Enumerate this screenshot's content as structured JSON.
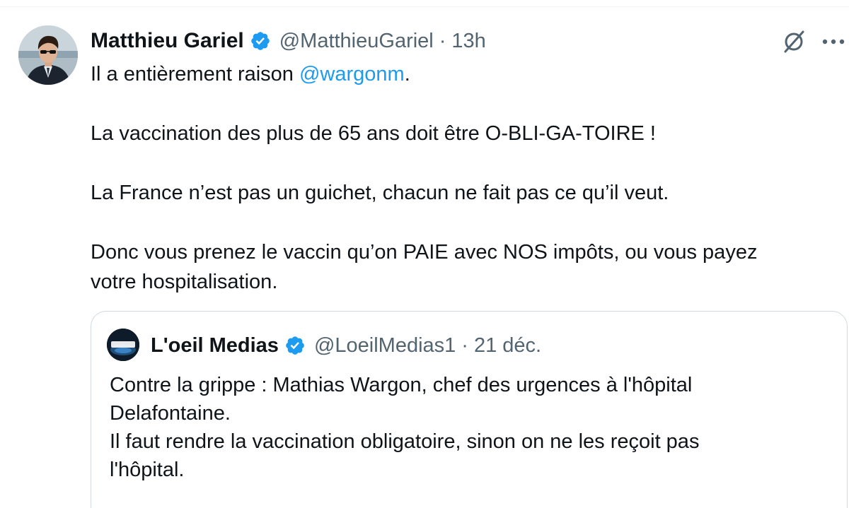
{
  "tweet": {
    "display_name": "Matthieu Gariel",
    "handle": "@MatthieuGariel",
    "separator": "·",
    "time": "13h",
    "text_line1_prefix": "Il a entièrement raison ",
    "text_line1_mention": "@wargonm",
    "text_line1_suffix": ".",
    "paragraph2": "La vaccination des plus de 65 ans doit être O-BLI-GA-TOIRE !",
    "paragraph3": "La France n’est pas un guichet, chacun ne fait pas ce qu’il veut.",
    "paragraph4_line1": "Donc vous prenez le vaccin qu’on PAIE avec NOS impôts, ou vous payez",
    "paragraph4_line2": "votre hospitalisation."
  },
  "quoted": {
    "display_name": "L'oeil Medias",
    "handle": "@LoeilMedias1",
    "separator": "·",
    "date": "21 déc.",
    "avatar_logo_text": "L'oeil Medias",
    "line1": "Contre la grippe : Mathias Wargon, chef des urgences à l'hôpital",
    "line2": "Delafontaine.",
    "line3": "Il faut rendre la vaccination obligatoire, sinon on ne les reçoit pas",
    "line4": "l'hôpital."
  },
  "icons": {
    "verified": "verified-badge-icon",
    "grok": "grok-icon",
    "more": "more-icon"
  },
  "colors": {
    "accent": "#1d9bf0",
    "text": "#0f1419",
    "secondary": "#536471",
    "border": "#cfd9de"
  }
}
